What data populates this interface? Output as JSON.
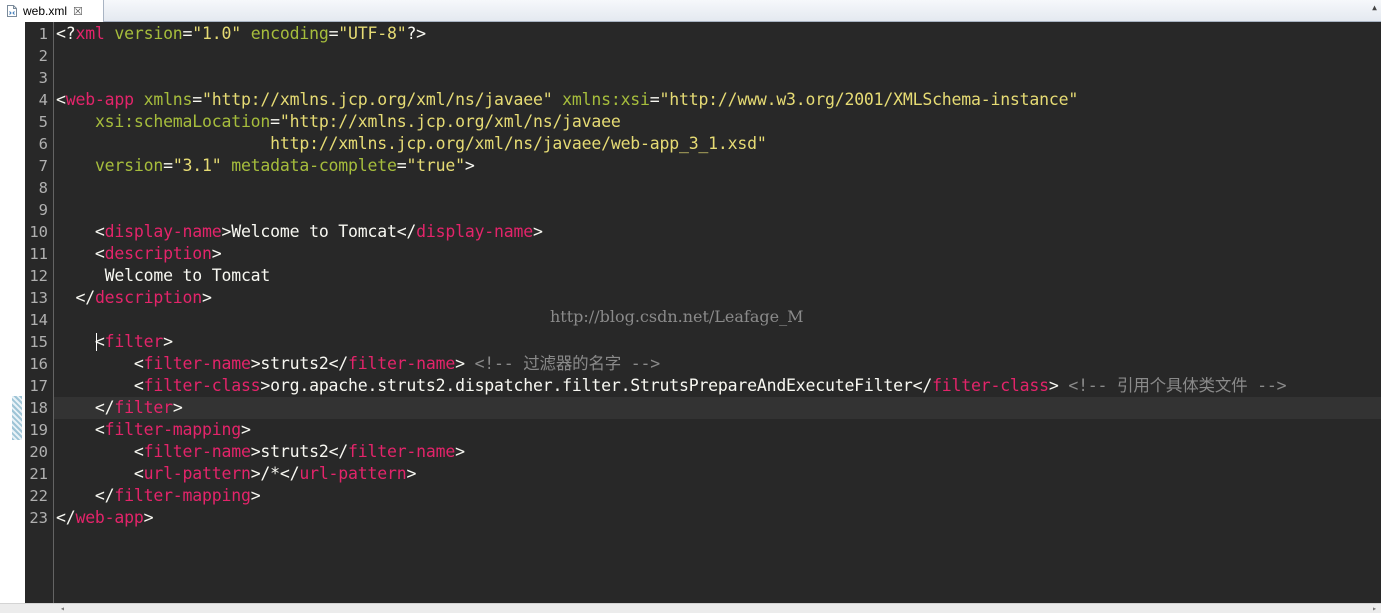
{
  "tab": {
    "filename": "web.xml",
    "close_glyph": "☒",
    "icon": "xml-file-icon"
  },
  "colors": {
    "tag": "#e3246a",
    "attr": "#a6bd3c",
    "string": "#e6db74",
    "text": "#f8f8f2",
    "punct": "#f8f8f2",
    "comment": "#8a8a8a",
    "background": "#282828",
    "line_numbers": "#b0b0b0"
  },
  "editor": {
    "current_line": 18,
    "caret_line": 15,
    "lines": [
      [
        [
          "punct",
          "<?"
        ],
        [
          "tag",
          "xml"
        ],
        [
          "punct",
          " "
        ],
        [
          "attr",
          "version"
        ],
        [
          "punct",
          "="
        ],
        [
          "string",
          "\"1.0\""
        ],
        [
          "punct",
          " "
        ],
        [
          "attr",
          "encoding"
        ],
        [
          "punct",
          "="
        ],
        [
          "string",
          "\"UTF-8\""
        ],
        [
          "punct",
          "?>"
        ]
      ],
      [],
      [],
      [
        [
          "punct",
          "<"
        ],
        [
          "tag",
          "web-app"
        ],
        [
          "punct",
          " "
        ],
        [
          "attr",
          "xmlns"
        ],
        [
          "punct",
          "="
        ],
        [
          "string",
          "\"http://xmlns.jcp.org/xml/ns/javaee\""
        ],
        [
          "punct",
          " "
        ],
        [
          "attr",
          "xmlns:xsi"
        ],
        [
          "punct",
          "="
        ],
        [
          "string",
          "\"http://www.w3.org/2001/XMLSchema-instance\""
        ]
      ],
      [
        [
          "punct",
          "    "
        ],
        [
          "attr",
          "xsi:schemaLocation"
        ],
        [
          "punct",
          "="
        ],
        [
          "string",
          "\"http://xmlns.jcp.org/xml/ns/javaee"
        ]
      ],
      [
        [
          "string",
          "                      http://xmlns.jcp.org/xml/ns/javaee/web-app_3_1.xsd\""
        ]
      ],
      [
        [
          "punct",
          "    "
        ],
        [
          "attr",
          "version"
        ],
        [
          "punct",
          "="
        ],
        [
          "string",
          "\"3.1\""
        ],
        [
          "punct",
          " "
        ],
        [
          "attr",
          "metadata-complete"
        ],
        [
          "punct",
          "="
        ],
        [
          "string",
          "\"true\""
        ],
        [
          "punct",
          ">"
        ]
      ],
      [],
      [],
      [
        [
          "punct",
          "    <"
        ],
        [
          "tag",
          "display-name"
        ],
        [
          "punct",
          ">"
        ],
        [
          "text",
          "Welcome to Tomcat"
        ],
        [
          "punct",
          "</"
        ],
        [
          "tag",
          "display-name"
        ],
        [
          "punct",
          ">"
        ]
      ],
      [
        [
          "punct",
          "    <"
        ],
        [
          "tag",
          "description"
        ],
        [
          "punct",
          ">"
        ]
      ],
      [
        [
          "text",
          "     Welcome to Tomcat"
        ]
      ],
      [
        [
          "punct",
          "  </"
        ],
        [
          "tag",
          "description"
        ],
        [
          "punct",
          ">"
        ]
      ],
      [],
      [
        [
          "punct",
          "    <"
        ],
        [
          "tag",
          "filter"
        ],
        [
          "punct",
          ">"
        ]
      ],
      [
        [
          "punct",
          "        <"
        ],
        [
          "tag",
          "filter-name"
        ],
        [
          "punct",
          ">"
        ],
        [
          "text",
          "struts2"
        ],
        [
          "punct",
          "</"
        ],
        [
          "tag",
          "filter-name"
        ],
        [
          "punct",
          ">"
        ],
        [
          "punct",
          " "
        ],
        [
          "comment",
          "<!-- 过滤器的名字 -->"
        ]
      ],
      [
        [
          "punct",
          "        <"
        ],
        [
          "tag",
          "filter-class"
        ],
        [
          "punct",
          ">"
        ],
        [
          "text",
          "org.apache.struts2.dispatcher.filter.StrutsPrepareAndExecuteFilter"
        ],
        [
          "punct",
          "</"
        ],
        [
          "tag",
          "filter-class"
        ],
        [
          "punct",
          ">"
        ],
        [
          "punct",
          " "
        ],
        [
          "comment",
          "<!-- 引用个具体类文件 -->"
        ]
      ],
      [
        [
          "punct",
          "    </"
        ],
        [
          "tag",
          "filter"
        ],
        [
          "punct",
          ">"
        ]
      ],
      [
        [
          "punct",
          "    <"
        ],
        [
          "tag",
          "filter-mapping"
        ],
        [
          "punct",
          ">"
        ]
      ],
      [
        [
          "punct",
          "        <"
        ],
        [
          "tag",
          "filter-name"
        ],
        [
          "punct",
          ">"
        ],
        [
          "text",
          "struts2"
        ],
        [
          "punct",
          "</"
        ],
        [
          "tag",
          "filter-name"
        ],
        [
          "punct",
          ">"
        ]
      ],
      [
        [
          "punct",
          "        <"
        ],
        [
          "tag",
          "url-pattern"
        ],
        [
          "punct",
          ">"
        ],
        [
          "text",
          "/*"
        ],
        [
          "punct",
          "</"
        ],
        [
          "tag",
          "url-pattern"
        ],
        [
          "punct",
          ">"
        ]
      ],
      [
        [
          "punct",
          "    </"
        ],
        [
          "tag",
          "filter-mapping"
        ],
        [
          "punct",
          ">"
        ]
      ],
      [
        [
          "punct",
          "</"
        ],
        [
          "tag",
          "web-app"
        ],
        [
          "punct",
          ">"
        ]
      ]
    ]
  },
  "watermark": "http://blog.csdn.net/Leafage_M"
}
